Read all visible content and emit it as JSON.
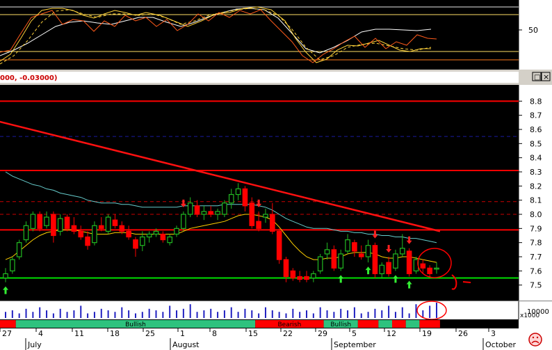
{
  "header": {
    "title_fragment": "000, -0.03000)",
    "maximize_glyph": "□",
    "close_glyph": "×"
  },
  "oscillator": {
    "level_label": "50"
  },
  "chart_data": {
    "type": "candlestick",
    "title": "",
    "ylim": [
      7.4,
      8.9
    ],
    "y_ticks": [
      7.5,
      7.6,
      7.7,
      7.8,
      7.9,
      8.0,
      8.1,
      8.2,
      8.3,
      8.4,
      8.5,
      8.6,
      8.7,
      8.8
    ],
    "x_day_labels": [
      "27",
      "4",
      "11",
      "18",
      "25",
      "1",
      "8",
      "15",
      "22",
      "29",
      "5",
      "12",
      "19",
      "26",
      "3"
    ],
    "x_month_labels": [
      "July",
      "August",
      "September",
      "October"
    ],
    "candles": [
      {
        "o": 7.55,
        "h": 7.62,
        "l": 7.52,
        "c": 7.58
      },
      {
        "o": 7.6,
        "h": 7.7,
        "l": 7.58,
        "c": 7.68
      },
      {
        "o": 7.7,
        "h": 7.82,
        "l": 7.68,
        "c": 7.8
      },
      {
        "o": 7.82,
        "h": 7.95,
        "l": 7.8,
        "c": 7.92
      },
      {
        "o": 7.9,
        "h": 8.02,
        "l": 7.88,
        "c": 8.0
      },
      {
        "o": 8.0,
        "h": 8.02,
        "l": 7.88,
        "c": 7.9
      },
      {
        "o": 7.92,
        "h": 8.02,
        "l": 7.9,
        "c": 7.98
      },
      {
        "o": 8.0,
        "h": 8.02,
        "l": 7.8,
        "c": 7.85
      },
      {
        "o": 7.88,
        "h": 8.0,
        "l": 7.85,
        "c": 7.97
      },
      {
        "o": 7.98,
        "h": 8.0,
        "l": 7.88,
        "c": 7.9
      },
      {
        "o": 7.92,
        "h": 7.98,
        "l": 7.86,
        "c": 7.88
      },
      {
        "o": 7.88,
        "h": 7.92,
        "l": 7.82,
        "c": 7.84
      },
      {
        "o": 7.84,
        "h": 7.88,
        "l": 7.75,
        "c": 7.78
      },
      {
        "o": 7.8,
        "h": 7.95,
        "l": 7.78,
        "c": 7.92
      },
      {
        "o": 7.92,
        "h": 7.98,
        "l": 7.88,
        "c": 7.9
      },
      {
        "o": 7.88,
        "h": 8.0,
        "l": 7.86,
        "c": 7.98
      },
      {
        "o": 7.96,
        "h": 8.0,
        "l": 7.9,
        "c": 7.92
      },
      {
        "o": 7.92,
        "h": 7.95,
        "l": 7.86,
        "c": 7.88
      },
      {
        "o": 7.88,
        "h": 7.92,
        "l": 7.82,
        "c": 7.84
      },
      {
        "o": 7.82,
        "h": 7.84,
        "l": 7.7,
        "c": 7.76
      },
      {
        "o": 7.78,
        "h": 7.88,
        "l": 7.74,
        "c": 7.84
      },
      {
        "o": 7.84,
        "h": 7.88,
        "l": 7.8,
        "c": 7.86
      },
      {
        "o": 7.86,
        "h": 7.9,
        "l": 7.84,
        "c": 7.88
      },
      {
        "o": 7.86,
        "h": 7.88,
        "l": 7.8,
        "c": 7.82
      },
      {
        "o": 7.8,
        "h": 7.86,
        "l": 7.78,
        "c": 7.84
      },
      {
        "o": 7.86,
        "h": 7.92,
        "l": 7.84,
        "c": 7.9
      },
      {
        "o": 7.9,
        "h": 8.02,
        "l": 7.88,
        "c": 8.0
      },
      {
        "o": 8.0,
        "h": 8.12,
        "l": 7.98,
        "c": 8.08
      },
      {
        "o": 8.06,
        "h": 8.1,
        "l": 7.98,
        "c": 8.0
      },
      {
        "o": 8.0,
        "h": 8.06,
        "l": 7.96,
        "c": 8.02
      },
      {
        "o": 8.02,
        "h": 8.06,
        "l": 7.98,
        "c": 8.0
      },
      {
        "o": 8.0,
        "h": 8.04,
        "l": 7.96,
        "c": 8.02
      },
      {
        "o": 8.0,
        "h": 8.1,
        "l": 7.98,
        "c": 8.08
      },
      {
        "o": 8.08,
        "h": 8.18,
        "l": 8.04,
        "c": 8.14
      },
      {
        "o": 8.14,
        "h": 8.22,
        "l": 8.1,
        "c": 8.18
      },
      {
        "o": 8.18,
        "h": 8.2,
        "l": 8.02,
        "c": 8.06
      },
      {
        "o": 8.08,
        "h": 8.12,
        "l": 7.9,
        "c": 7.92
      },
      {
        "o": 7.95,
        "h": 8.02,
        "l": 7.88,
        "c": 7.9
      },
      {
        "o": 7.98,
        "h": 8.04,
        "l": 7.94,
        "c": 8.0
      },
      {
        "o": 8.0,
        "h": 8.08,
        "l": 7.86,
        "c": 7.88
      },
      {
        "o": 7.88,
        "h": 7.9,
        "l": 7.65,
        "c": 7.68
      },
      {
        "o": 7.68,
        "h": 7.7,
        "l": 7.52,
        "c": 7.56
      },
      {
        "o": 7.6,
        "h": 7.62,
        "l": 7.53,
        "c": 7.55
      },
      {
        "o": 7.56,
        "h": 7.6,
        "l": 7.52,
        "c": 7.54
      },
      {
        "o": 7.56,
        "h": 7.6,
        "l": 7.52,
        "c": 7.54
      },
      {
        "o": 7.55,
        "h": 7.6,
        "l": 7.52,
        "c": 7.58
      },
      {
        "o": 7.6,
        "h": 7.72,
        "l": 7.58,
        "c": 7.7
      },
      {
        "o": 7.72,
        "h": 7.8,
        "l": 7.68,
        "c": 7.75
      },
      {
        "o": 7.75,
        "h": 7.78,
        "l": 7.6,
        "c": 7.62
      },
      {
        "o": 7.62,
        "h": 7.75,
        "l": 7.6,
        "c": 7.72
      },
      {
        "o": 7.74,
        "h": 7.86,
        "l": 7.72,
        "c": 7.82
      },
      {
        "o": 7.8,
        "h": 7.82,
        "l": 7.7,
        "c": 7.74
      },
      {
        "o": 7.72,
        "h": 7.78,
        "l": 7.68,
        "c": 7.7
      },
      {
        "o": 7.7,
        "h": 7.82,
        "l": 7.66,
        "c": 7.78
      },
      {
        "o": 7.78,
        "h": 7.8,
        "l": 7.55,
        "c": 7.58
      },
      {
        "o": 7.58,
        "h": 7.66,
        "l": 7.55,
        "c": 7.64
      },
      {
        "o": 7.66,
        "h": 7.7,
        "l": 7.56,
        "c": 7.58
      },
      {
        "o": 7.62,
        "h": 7.75,
        "l": 7.6,
        "c": 7.72
      },
      {
        "o": 7.72,
        "h": 7.86,
        "l": 7.7,
        "c": 7.76
      },
      {
        "o": 7.74,
        "h": 7.76,
        "l": 7.56,
        "c": 7.58
      },
      {
        "o": 7.6,
        "h": 7.7,
        "l": 7.58,
        "c": 7.68
      },
      {
        "o": 7.65,
        "h": 7.68,
        "l": 7.58,
        "c": 7.62
      },
      {
        "o": 7.62,
        "h": 7.64,
        "l": 7.56,
        "c": 7.58
      },
      {
        "o": 7.62,
        "h": 7.66,
        "l": 7.58,
        "c": 7.62
      }
    ],
    "moving_average_yellow": [
      7.68,
      7.7,
      7.74,
      7.78,
      7.82,
      7.85,
      7.87,
      7.88,
      7.89,
      7.89,
      7.89,
      7.88,
      7.87,
      7.86,
      7.86,
      7.86,
      7.87,
      7.87,
      7.87,
      7.86,
      7.86,
      7.86,
      7.86,
      7.86,
      7.86,
      7.86,
      7.88,
      7.9,
      7.91,
      7.92,
      7.93,
      7.94,
      7.95,
      7.97,
      7.99,
      8.0,
      8.0,
      7.99,
      7.98,
      7.96,
      7.91,
      7.85,
      7.79,
      7.74,
      7.7,
      7.68,
      7.68,
      7.69,
      7.69,
      7.7,
      7.72,
      7.73,
      7.73,
      7.73,
      7.72,
      7.7,
      7.69,
      7.69,
      7.7,
      7.7,
      7.69,
      7.68,
      7.67,
      7.66
    ],
    "moving_average_cyan": [
      8.3,
      8.27,
      8.25,
      8.23,
      8.21,
      8.2,
      8.18,
      8.17,
      8.15,
      8.14,
      8.13,
      8.12,
      8.1,
      8.09,
      8.08,
      8.08,
      8.08,
      8.07,
      8.07,
      8.06,
      8.05,
      8.05,
      8.05,
      8.05,
      8.05,
      8.05,
      8.06,
      8.06,
      8.06,
      8.06,
      8.06,
      8.06,
      8.07,
      8.07,
      8.07,
      8.07,
      8.07,
      8.06,
      8.05,
      8.03,
      8.0,
      7.97,
      7.95,
      7.93,
      7.91,
      7.9,
      7.9,
      7.9,
      7.89,
      7.88,
      7.88,
      7.87,
      7.87,
      7.86,
      7.86,
      7.85,
      7.85,
      7.84,
      7.84,
      7.83,
      7.83,
      7.82,
      7.81,
      7.8
    ],
    "horizontal_levels": [
      {
        "value": 8.8,
        "style": "solid",
        "color": "#ff0000"
      },
      {
        "value": 8.31,
        "style": "solid",
        "color": "#ff0000"
      },
      {
        "value": 8.55,
        "style": "dashed",
        "color": "#1a1aa0"
      },
      {
        "value": 8.09,
        "style": "dashed",
        "color": "#cc0000"
      },
      {
        "value": 8.0,
        "style": "dashed",
        "color": "#cc0000"
      },
      {
        "value": 7.89,
        "style": "solid",
        "color": "#ff0000"
      },
      {
        "value": 7.55,
        "style": "solid",
        "color": "#00e000"
      }
    ],
    "trendline": {
      "start_index": -1.3,
      "start_value": 8.66,
      "end_index": 63.5,
      "end_value": 7.88,
      "color": "#ff1010"
    },
    "up_arrow_indices": [
      0,
      49,
      53,
      57,
      59
    ],
    "down_arrow_indices": [
      26,
      37,
      54,
      56,
      59
    ],
    "volume": [
      4,
      5,
      3,
      6,
      4,
      7,
      5,
      3,
      6,
      4,
      5,
      8,
      3,
      4,
      6,
      5,
      4,
      7,
      5,
      3,
      4,
      6,
      5,
      4,
      8,
      5,
      6,
      9,
      4,
      5,
      6,
      4,
      5,
      7,
      4,
      6,
      5,
      3,
      7,
      5,
      4,
      3,
      6,
      4,
      5,
      3,
      7,
      5,
      4,
      6,
      5,
      7,
      3,
      4,
      6,
      5,
      8,
      4,
      7,
      3,
      9,
      5,
      8,
      10
    ],
    "volume_unit_label": "x1000",
    "volume_tick_label": "10000",
    "signal_band": [
      {
        "label": "",
        "from": 0,
        "to": 2,
        "color": "#ff0000"
      },
      {
        "label": "Bullish",
        "from": 2,
        "to": 37,
        "color": "#2ec27e"
      },
      {
        "label": "Bearish",
        "from": 37,
        "to": 47,
        "color": "#ff0000"
      },
      {
        "label": "Bullish",
        "from": 47,
        "to": 52,
        "color": "#2ec27e"
      },
      {
        "label": "",
        "from": 52,
        "to": 55,
        "color": "#ff0000"
      },
      {
        "label": "",
        "from": 55,
        "to": 57,
        "color": "#2ec27e"
      },
      {
        "label": "",
        "from": 57,
        "to": 59,
        "color": "#ff0000"
      },
      {
        "label": "",
        "from": 59,
        "to": 61,
        "color": "#2ec27e"
      },
      {
        "label": "",
        "from": 61,
        "to": 64,
        "color": "#ff0000"
      }
    ],
    "colors": {
      "up": "#22bb22",
      "down": "#ff0000",
      "background": "#000000",
      "ma_yellow": "#ffd000",
      "ma_cyan": "#66cccc"
    }
  }
}
